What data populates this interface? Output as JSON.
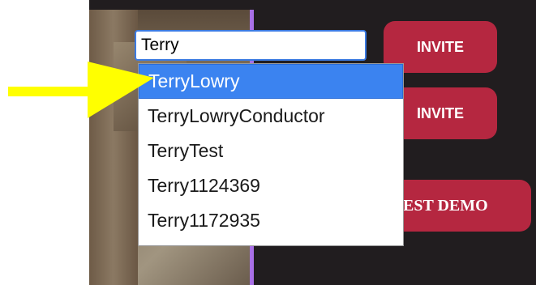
{
  "search": {
    "value": "Terry"
  },
  "dropdown": {
    "items": [
      "TerryLowry",
      "TerryLowryConductor",
      "TerryTest",
      "Terry1124369",
      "Terry1172935"
    ],
    "selected_index": 0
  },
  "buttons": {
    "invite_1": "INVITE",
    "invite_2": "INVITE",
    "request_demo": "EST DEMO"
  },
  "colors": {
    "button": "#b52740",
    "selection": "#3b83f0",
    "arrow": "#ffff00",
    "panel": "#211d1f",
    "accent_line": "#a970e6"
  }
}
